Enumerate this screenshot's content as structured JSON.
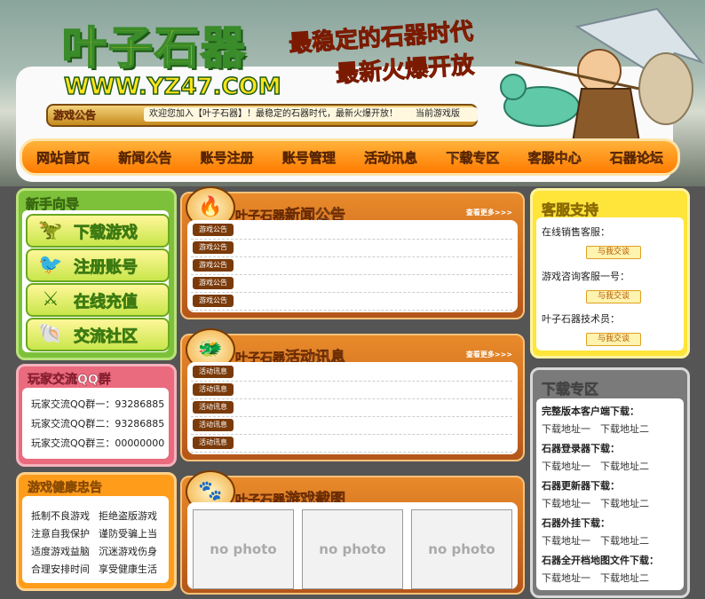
{
  "header": {
    "logo": "叶子石器",
    "url": "WWW.YZ47.COM",
    "slogan1": "最稳定的石器时代",
    "slogan2": "最新火爆开放",
    "notice_label": "游戏公告",
    "notice_text": "欢迎您加入【叶子石器】！最稳定的石器时代，最新火爆开放！　　当前游戏版"
  },
  "nav": [
    "网站首页",
    "新闻公告",
    "账号注册",
    "账号管理",
    "活动讯息",
    "下载专区",
    "客服中心",
    "石器论坛"
  ],
  "guide": {
    "title": "新手向导",
    "buttons": [
      "下载游戏",
      "注册账号",
      "在线充值",
      "交流社区"
    ]
  },
  "qq": {
    "title": "玩家交流QQ群",
    "groups": [
      "玩家交流QQ群一：93286885",
      "玩家交流QQ群二：93286885",
      "玩家交流QQ群三：00000000"
    ]
  },
  "health": {
    "title": "游戏健康忠告",
    "tips": [
      "抵制不良游戏",
      "拒绝盗版游戏",
      "注意自我保护",
      "谨防受骗上当",
      "适度游戏益脑",
      "沉迷游戏伤身",
      "合理安排时间",
      "享受健康生活"
    ]
  },
  "news": {
    "brand": "叶子石器",
    "title": "新闻公告",
    "more": "查看更多>>>",
    "tags": [
      "游戏公告",
      "游戏公告",
      "游戏公告",
      "游戏公告",
      "游戏公告"
    ]
  },
  "events": {
    "brand": "叶子石器",
    "title": "活动讯息",
    "more": "查看更多>>>",
    "tags": [
      "活动讯息",
      "活动讯息",
      "活动讯息",
      "活动讯息",
      "活动讯息"
    ]
  },
  "shots": {
    "brand": "叶子石器",
    "title": "游戏截图",
    "photos": [
      "no photo",
      "no photo",
      "no photo"
    ]
  },
  "service": {
    "title": "客服支持",
    "items": [
      {
        "label": "在线销售客服：",
        "button": "与我交谈"
      },
      {
        "label": "游戏咨询客服一号：",
        "button": "与我交谈"
      },
      {
        "label": "叶子石器技术员：",
        "button": "与我交谈"
      }
    ]
  },
  "downloads": {
    "title": "下载专区",
    "sections": [
      {
        "heading": "完整版本客户端下载：",
        "links": [
          "下载地址一",
          "下载地址二"
        ]
      },
      {
        "heading": "石器登录器下载：",
        "links": [
          "下载地址一",
          "下载地址二"
        ]
      },
      {
        "heading": "石器更新器下载：",
        "links": [
          "下载地址一",
          "下载地址二"
        ]
      },
      {
        "heading": "石器外挂下载：",
        "links": [
          "下载地址一",
          "下载地址二"
        ]
      },
      {
        "heading": "石器全开档地图文件下载：",
        "links": [
          "下载地址一",
          "下载地址二"
        ]
      }
    ]
  }
}
